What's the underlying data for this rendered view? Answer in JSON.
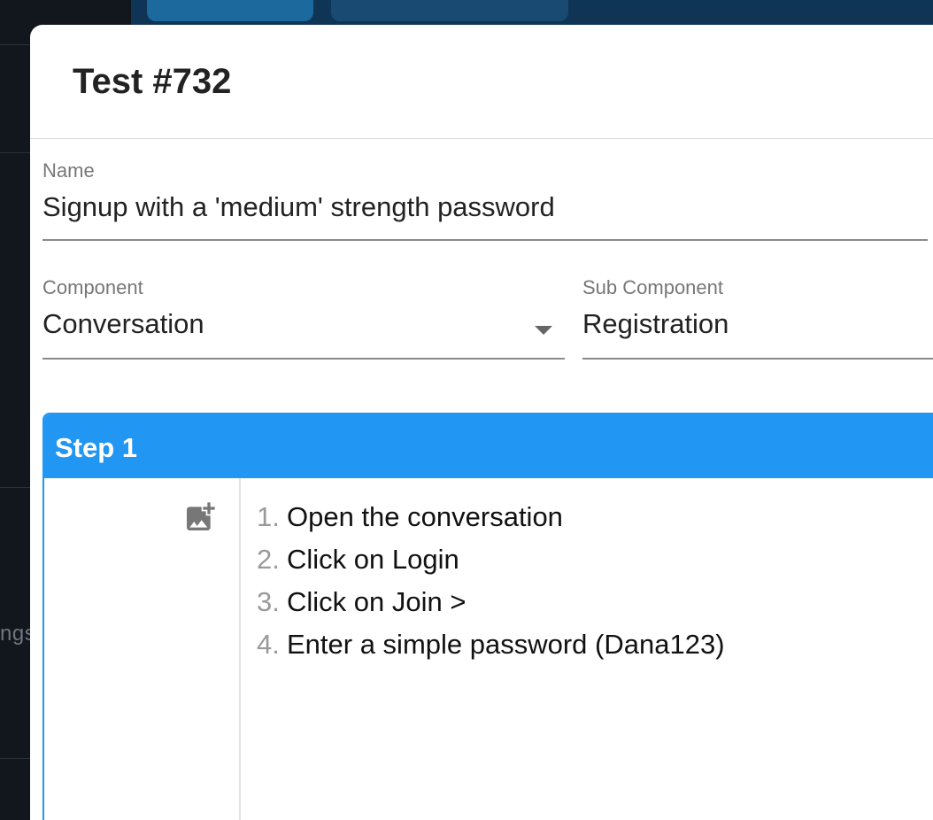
{
  "background": {
    "sidebar_partial_label": "ngs"
  },
  "modal": {
    "title": "Test #732",
    "name": {
      "label": "Name",
      "value": "Signup with a 'medium' strength password"
    },
    "component": {
      "label": "Component",
      "value": "Conversation"
    },
    "sub_component": {
      "label": "Sub Component",
      "value": "Registration"
    },
    "step": {
      "title": "Step 1",
      "add_image_icon": "add-photo-icon",
      "items": [
        {
          "num": "1.",
          "text": "Open the conversation"
        },
        {
          "num": "2.",
          "text": "Click on Login"
        },
        {
          "num": "3.",
          "text": "Click on Join >"
        },
        {
          "num": "4.",
          "text": "Enter a simple password (Dana123)"
        }
      ]
    }
  },
  "colors": {
    "accent": "#2196f3",
    "header_text": "#222222",
    "label_text": "#777777"
  }
}
